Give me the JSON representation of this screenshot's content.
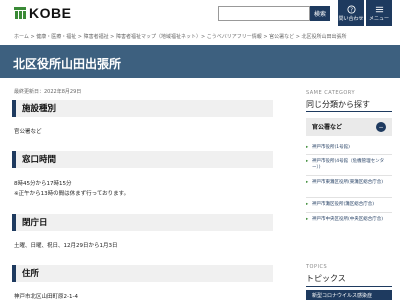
{
  "header": {
    "logo_text": "KOBE",
    "search_button": "検索",
    "inquiry_label": "問い合わせ",
    "menu_label": "メニュー"
  },
  "breadcrumb": "ホーム > 健康・医療・福祉 > 障害者福祉 > 障害者福祉マップ（地域福祉ネット）> こうべバリアフリー情報 > 官公署など > 北区役所山田出張所",
  "page_title": "北区役所山田出張所",
  "updated": "最終更新日：2022年8月29日",
  "sections": [
    {
      "heading": "施設種別",
      "lines": [
        "官公署など"
      ]
    },
    {
      "heading": "窓口時間",
      "lines": [
        "8時45分から17時15分",
        "※正午から13時の間は休まず行っております。"
      ]
    },
    {
      "heading": "閉庁日",
      "lines": [
        "土曜、日曜、祝日、12月29日から1月3日"
      ]
    },
    {
      "heading": "住所",
      "lines": [
        "神戸市北区山田町原2-1-4"
      ]
    }
  ],
  "sidebar": {
    "same_category_en": "SAME CATEGORY",
    "same_category_jp": "同じ分類から探す",
    "category": "官公署など",
    "toggle": "−",
    "links": [
      "神戸市役所(1号館)",
      "神戸市役所(4号館（危機管理センター）)",
      "神戸市東灘区役所(東灘区総合庁舎)",
      "神戸市灘区役所(灘区総合庁舎)",
      "神戸市中央区役所(中央区総合庁舎)"
    ],
    "topics_en": "TOPICS",
    "topics_jp": "トピックス",
    "topic_item": "新型コロナウイルス感染症"
  }
}
